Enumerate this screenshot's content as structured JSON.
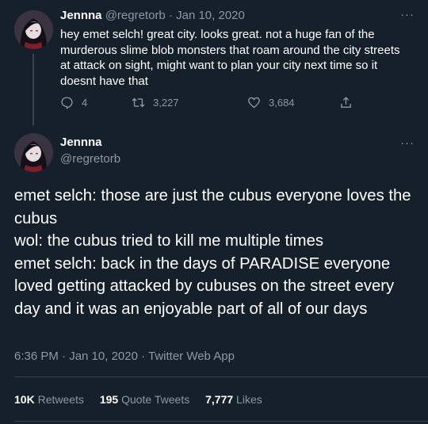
{
  "parent_tweet": {
    "author_name": "Jennna",
    "meta": "@regretorb · Jan 10, 2020",
    "text": "hey emet selch! great city. looks great. not a huge fan of the murderous slime blob monsters that roam around the city streets at attack on sight, might want to plan your city next time so it doesnt have that",
    "replies": "4",
    "retweets": "3,227",
    "likes": "3,684"
  },
  "main_tweet": {
    "author_name": "Jennna",
    "handle": "@regretorb",
    "text": "emet selch: those are just the cubus everyone loves the cubus\nwol: the cubus tried to kill me multiple times\nemet selch: back in the days of PARADISE everyone loved getting attacked by cubuses on the street every day and it was an enjoyable part of all of our days",
    "timestamp_line": "6:36 PM · Jan 10, 2020 · Twitter Web App",
    "stats": {
      "retweets_count": "10K",
      "retweets_label": "Retweets",
      "quote_count": "195",
      "quote_label": "Quote Tweets",
      "likes_count": "7,777",
      "likes_label": "Likes"
    }
  },
  "more_glyph": "···",
  "colors": {
    "background": "#15202b",
    "text_primary": "#ffffff",
    "text_secondary": "#8b98a5",
    "border": "#38444d"
  },
  "icons": [
    "reply-icon",
    "retweet-icon",
    "like-icon",
    "share-icon",
    "more-icon"
  ]
}
